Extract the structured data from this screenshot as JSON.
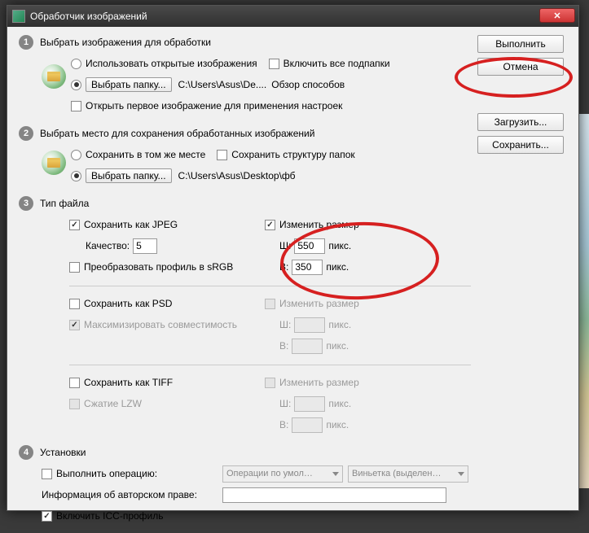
{
  "window": {
    "title": "Обработчик изображений",
    "close": "✕"
  },
  "side": {
    "run": "Выполнить",
    "cancel": "Отмена",
    "load": "Загрузить...",
    "save": "Сохранить..."
  },
  "sec1": {
    "num": "1",
    "title": "Выбрать изображения для обработки",
    "use_open": "Использовать открытые изображения",
    "include_sub": "Включить все подпапки",
    "choose_folder": "Выбрать папку...",
    "path": "C:\\Users\\Asus\\De....",
    "browse_methods": "Обзор способов",
    "open_first": "Открыть первое изображение для применения настроек"
  },
  "sec2": {
    "num": "2",
    "title": "Выбрать место для сохранения обработанных изображений",
    "same_place": "Сохранить в том же месте",
    "keep_structure": "Сохранить структуру папок",
    "choose_folder": "Выбрать папку...",
    "path": "C:\\Users\\Asus\\Desktop\\фб"
  },
  "sec3": {
    "num": "3",
    "title": "Тип файла",
    "jpeg": {
      "save": "Сохранить как JPEG",
      "quality_label": "Качество:",
      "quality": "5",
      "srgb": "Преобразовать профиль в sRGB",
      "resize": "Изменить размер",
      "w_label": "Ш:",
      "w": "550",
      "h_label": "В:",
      "h": "350",
      "px": "пикс."
    },
    "psd": {
      "save": "Сохранить как PSD",
      "maxcompat": "Максимизировать совместимость",
      "resize": "Изменить размер",
      "w_label": "Ш:",
      "h_label": "В:",
      "px": "пикс."
    },
    "tiff": {
      "save": "Сохранить как TIFF",
      "lzw": "Сжатие LZW",
      "resize": "Изменить размер",
      "w_label": "Ш:",
      "h_label": "В:",
      "px": "пикс."
    }
  },
  "sec4": {
    "num": "4",
    "title": "Установки",
    "run_action": "Выполнить операцию:",
    "action_set": "Операции по умол…",
    "action": "Виньетка (выделен…",
    "copyright_label": "Информация об авторском праве:",
    "copyright_value": "",
    "icc": "Включить ICC-профиль"
  }
}
